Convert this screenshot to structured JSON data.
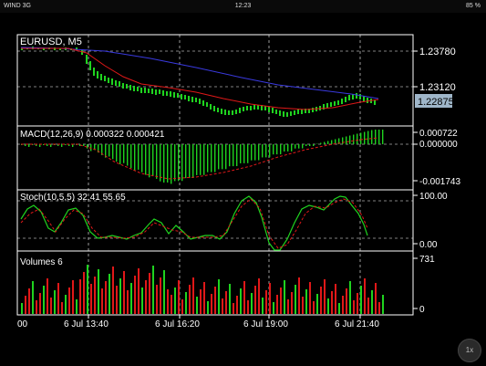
{
  "status_bar": {
    "carrier": "WIND 3G",
    "time": "12:23",
    "battery": "85 %"
  },
  "price_panel": {
    "title": "EURUSD, M5",
    "levels": [
      "1.23780",
      "1.23120"
    ],
    "current_price": "1.22875"
  },
  "macd_panel": {
    "title": "MACD(12,26,9) 0.000322 0.000421",
    "levels": [
      "0.000722",
      "0.000000",
      "-0.001743"
    ]
  },
  "stoch_panel": {
    "title": "Stoch(10,5,5) 32.41 55.65",
    "levels": [
      "100.00",
      "0.00"
    ]
  },
  "volume_panel": {
    "title": "Volumes 6",
    "levels": [
      "731",
      "0"
    ]
  },
  "time_axis": {
    "labels": [
      "00",
      "6 Jul 13:40",
      "6 Jul 16:20",
      "6 Jul 19:00",
      "6 Jul 21:40"
    ]
  },
  "zoom_button": {
    "label": "1x"
  },
  "colors": {
    "background": "#000000",
    "grid": "#ffffff",
    "bull": "#1fd31f",
    "bear": "#e01818",
    "ma_fast": "#e01818",
    "ma_slow": "#3a3ae0",
    "price_tag": "#9fb6c9"
  }
}
